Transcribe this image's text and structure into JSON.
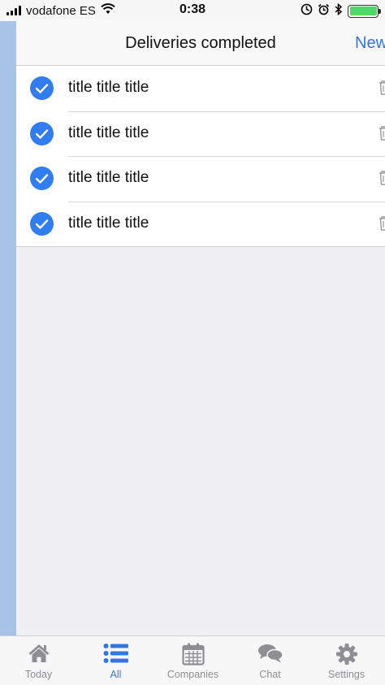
{
  "status_bar": {
    "carrier": "vodafone ES",
    "time": "0:38",
    "battery_level": 1.0,
    "icons": [
      "signal-icon",
      "wifi-icon",
      "location-lock-icon",
      "alarm-icon",
      "bluetooth-icon",
      "battery-icon"
    ]
  },
  "nav": {
    "title": "Deliveries completed",
    "new_label": "New"
  },
  "deliveries": [
    {
      "title": "title title title",
      "completed": true
    },
    {
      "title": "title title title",
      "completed": true
    },
    {
      "title": "title title title",
      "completed": true
    },
    {
      "title": "title title title",
      "completed": true
    }
  ],
  "tabs": [
    {
      "label": "Today",
      "icon": "home-icon",
      "active": false
    },
    {
      "label": "All",
      "icon": "list-icon",
      "active": true
    },
    {
      "label": "Companies",
      "icon": "calendar-icon",
      "active": false
    },
    {
      "label": "Chat",
      "icon": "chat-icon",
      "active": false
    },
    {
      "label": "Settings",
      "icon": "gear-icon",
      "active": false
    }
  ],
  "colors": {
    "accent": "#2f78e4",
    "check": "#2f7cf3",
    "battery": "#4cd964",
    "tab_inactive": "#8e8e93"
  }
}
